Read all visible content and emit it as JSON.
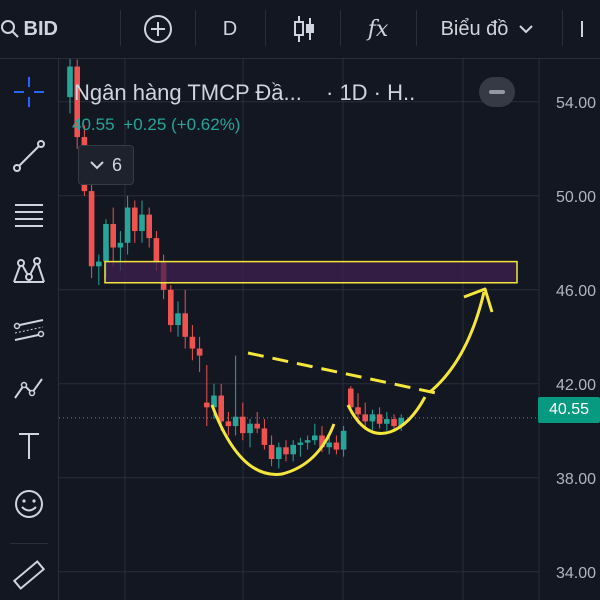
{
  "toolbar": {
    "symbol": "BID",
    "add_label": "+",
    "interval": "D",
    "indicators_label": "fx",
    "chart_mode": "Biểu đồ"
  },
  "legend": {
    "title": "Ngân hàng TMCP Đầ...",
    "suffix": "· 1D · H..",
    "last": "40.55",
    "change": "+0.25 (+0.62%)",
    "indicator_count": "6"
  },
  "price_axis": {
    "ticks": [
      "54.00",
      "50.00",
      "46.00",
      "42.00",
      "38.00",
      "34.00"
    ],
    "current_price": "40.55",
    "current_color": "#089981"
  },
  "sidebar": {
    "tools": [
      "crosshair-icon",
      "trend-line-icon",
      "fib-lines-icon",
      "pattern-icon",
      "parallel-channel-icon",
      "polyline-icon",
      "text-tool-icon",
      "emoji-icon",
      "ruler-icon"
    ]
  },
  "colors": {
    "up": "#26a69a",
    "down": "#ef5350",
    "zone_fill": "#3f2050",
    "annotation": "#f5e63b",
    "background": "#131722"
  },
  "chart_data": {
    "type": "candlestick",
    "y_range": [
      32.8,
      55.2
    ],
    "current": 40.55,
    "annotations": [
      {
        "kind": "rectangle",
        "label": "",
        "y_range": [
          46.3,
          47.2
        ]
      },
      {
        "kind": "cup-and-handle-outline",
        "label": ""
      },
      {
        "kind": "dashed-resistance-line",
        "label": ""
      },
      {
        "kind": "arrow-up",
        "label": ""
      }
    ]
  }
}
